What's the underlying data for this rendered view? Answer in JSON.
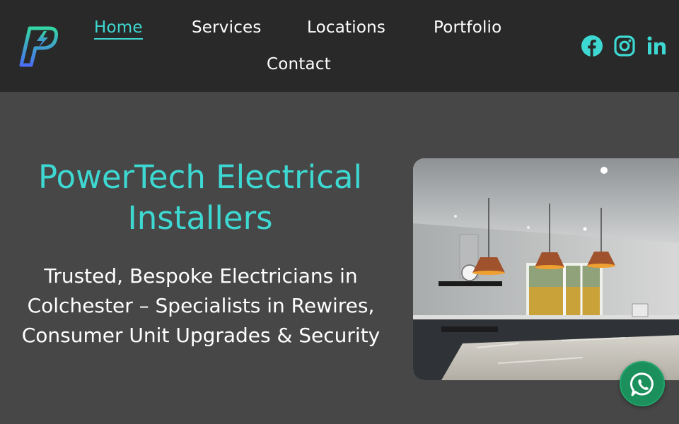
{
  "brand": {
    "accent_color": "#3ed8d2",
    "logo_icon": "lightning-p-logo-icon"
  },
  "nav": {
    "items": [
      {
        "label": "Home",
        "active": true
      },
      {
        "label": "Services",
        "active": false
      },
      {
        "label": "Locations",
        "active": false
      },
      {
        "label": "Portfolio",
        "active": false
      },
      {
        "label": "Contact",
        "active": false
      }
    ]
  },
  "social": {
    "icons": [
      "facebook-icon",
      "instagram-icon",
      "linkedin-icon"
    ]
  },
  "hero": {
    "title": "PowerTech Electrical Installers",
    "subtitle": "Trusted, Bespoke Electricians in Colchester – Specialists in Rewires, Consumer Unit Upgrades & Security",
    "image": "kitchen-pendant-lights-photo"
  },
  "floating": {
    "icon": "whatsapp-icon"
  }
}
